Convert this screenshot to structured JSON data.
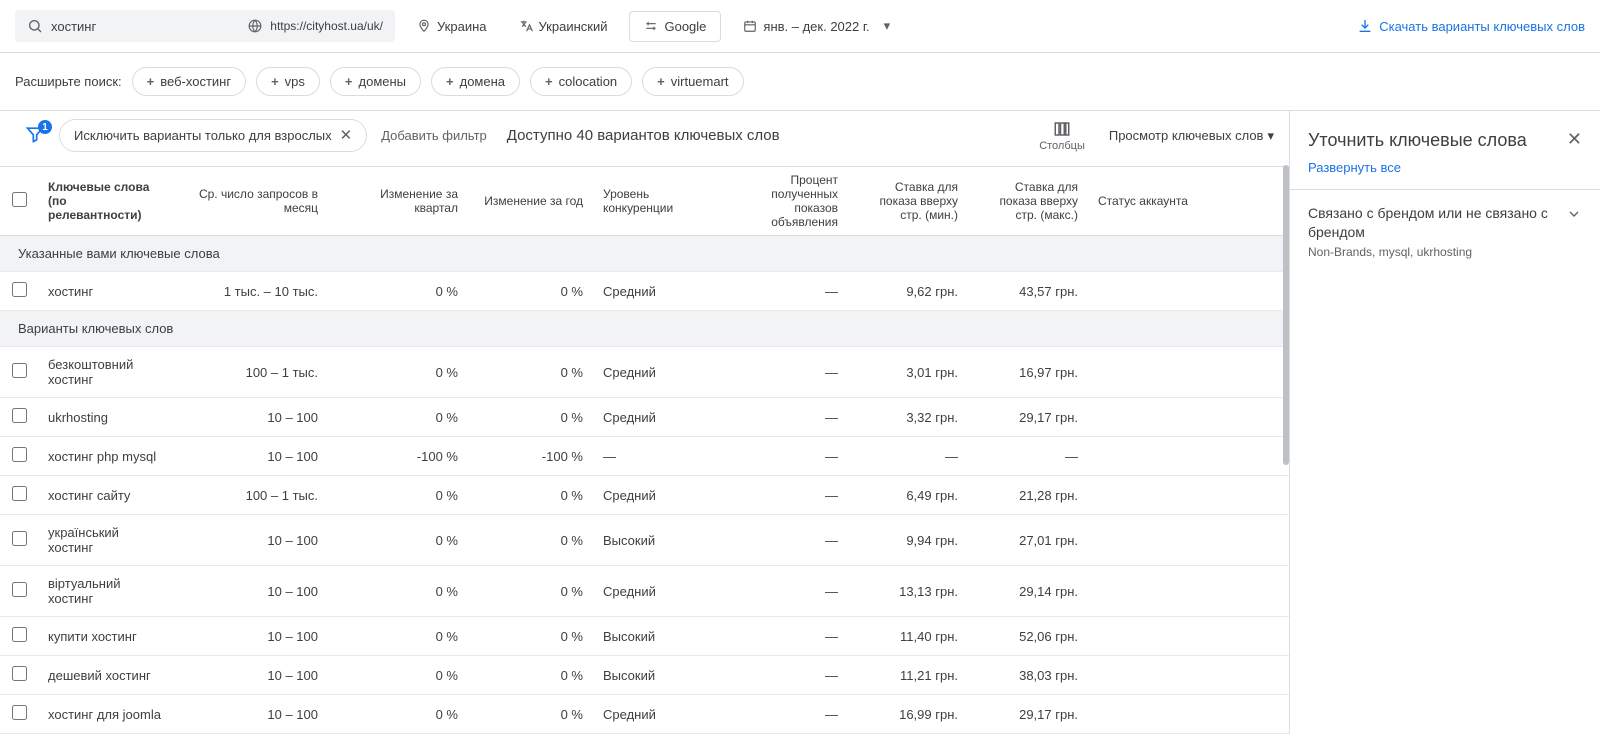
{
  "topbar": {
    "search_value": "хостинг",
    "site_url": "https://cityhost.ua/uk/",
    "location": "Украина",
    "language": "Украинский",
    "network": "Google",
    "date_range": "янв. – дек. 2022 г.",
    "download_label": "Скачать варианты ключевых слов"
  },
  "expand": {
    "label": "Расширьте поиск:",
    "pills": [
      "веб-хостинг",
      "vps",
      "домены",
      "домена",
      "colocation",
      "virtuemart"
    ]
  },
  "toolbar": {
    "funnel_badge": "1",
    "active_filter": "Исключить варианты только для взрослых",
    "add_filter": "Добавить фильтр",
    "available_text": "Доступно 40 вариантов ключевых слов",
    "columns_label": "Столбцы",
    "view_label": "Просмотр ключевых слов"
  },
  "table": {
    "headers": {
      "keyword": "Ключевые слова (по релевантности)",
      "avg": "Ср. число запросов в месяц",
      "q_change": "Изменение за квартал",
      "y_change": "Изменение за год",
      "competition": "Уровень конкуренции",
      "impressions": "Процент полученных показов объявления",
      "bid_min": "Ставка для показа вверху стр. (мин.)",
      "bid_max": "Ставка для показа вверху стр. (макс.)",
      "status": "Статус аккаунта"
    },
    "section1_title": "Указанные вами ключевые слова",
    "section1_rows": [
      {
        "kw": "хостинг",
        "avg": "1 тыс. – 10 тыс.",
        "qc": "0 %",
        "yc": "0 %",
        "comp": "Средний",
        "imp": "—",
        "min": "9,62 грн.",
        "max": "43,57 грн.",
        "st": ""
      }
    ],
    "section2_title": "Варианты ключевых слов",
    "section2_rows": [
      {
        "kw": "безкоштовний хостинг",
        "avg": "100 – 1 тыс.",
        "qc": "0 %",
        "yc": "0 %",
        "comp": "Средний",
        "imp": "—",
        "min": "3,01 грн.",
        "max": "16,97 грн.",
        "st": ""
      },
      {
        "kw": "ukrhosting",
        "avg": "10 – 100",
        "qc": "0 %",
        "yc": "0 %",
        "comp": "Средний",
        "imp": "—",
        "min": "3,32 грн.",
        "max": "29,17 грн.",
        "st": ""
      },
      {
        "kw": "хостинг php mysql",
        "avg": "10 – 100",
        "qc": "-100 %",
        "yc": "-100 %",
        "comp": "—",
        "imp": "—",
        "min": "—",
        "max": "—",
        "st": ""
      },
      {
        "kw": "хостинг сайту",
        "avg": "100 – 1 тыс.",
        "qc": "0 %",
        "yc": "0 %",
        "comp": "Средний",
        "imp": "—",
        "min": "6,49 грн.",
        "max": "21,28 грн.",
        "st": ""
      },
      {
        "kw": "український хостинг",
        "avg": "10 – 100",
        "qc": "0 %",
        "yc": "0 %",
        "comp": "Высокий",
        "imp": "—",
        "min": "9,94 грн.",
        "max": "27,01 грн.",
        "st": ""
      },
      {
        "kw": "віртуальний хостинг",
        "avg": "10 – 100",
        "qc": "0 %",
        "yc": "0 %",
        "comp": "Средний",
        "imp": "—",
        "min": "13,13 грн.",
        "max": "29,14 грн.",
        "st": ""
      },
      {
        "kw": "купити хостинг",
        "avg": "10 – 100",
        "qc": "0 %",
        "yc": "0 %",
        "comp": "Высокий",
        "imp": "—",
        "min": "11,40 грн.",
        "max": "52,06 грн.",
        "st": ""
      },
      {
        "kw": "дешевий хостинг",
        "avg": "10 – 100",
        "qc": "0 %",
        "yc": "0 %",
        "comp": "Высокий",
        "imp": "—",
        "min": "11,21 грн.",
        "max": "38,03 грн.",
        "st": ""
      },
      {
        "kw": "хостинг для joomla",
        "avg": "10 – 100",
        "qc": "0 %",
        "yc": "0 %",
        "comp": "Средний",
        "imp": "—",
        "min": "16,99 грн.",
        "max": "29,17 грн.",
        "st": ""
      }
    ]
  },
  "right_panel": {
    "title": "Уточнить ключевые слова",
    "expand_all": "Развернуть все",
    "section_title": "Связано с брендом или не связано с брендом",
    "section_sub": "Non-Brands, mysql, ukrhosting"
  }
}
